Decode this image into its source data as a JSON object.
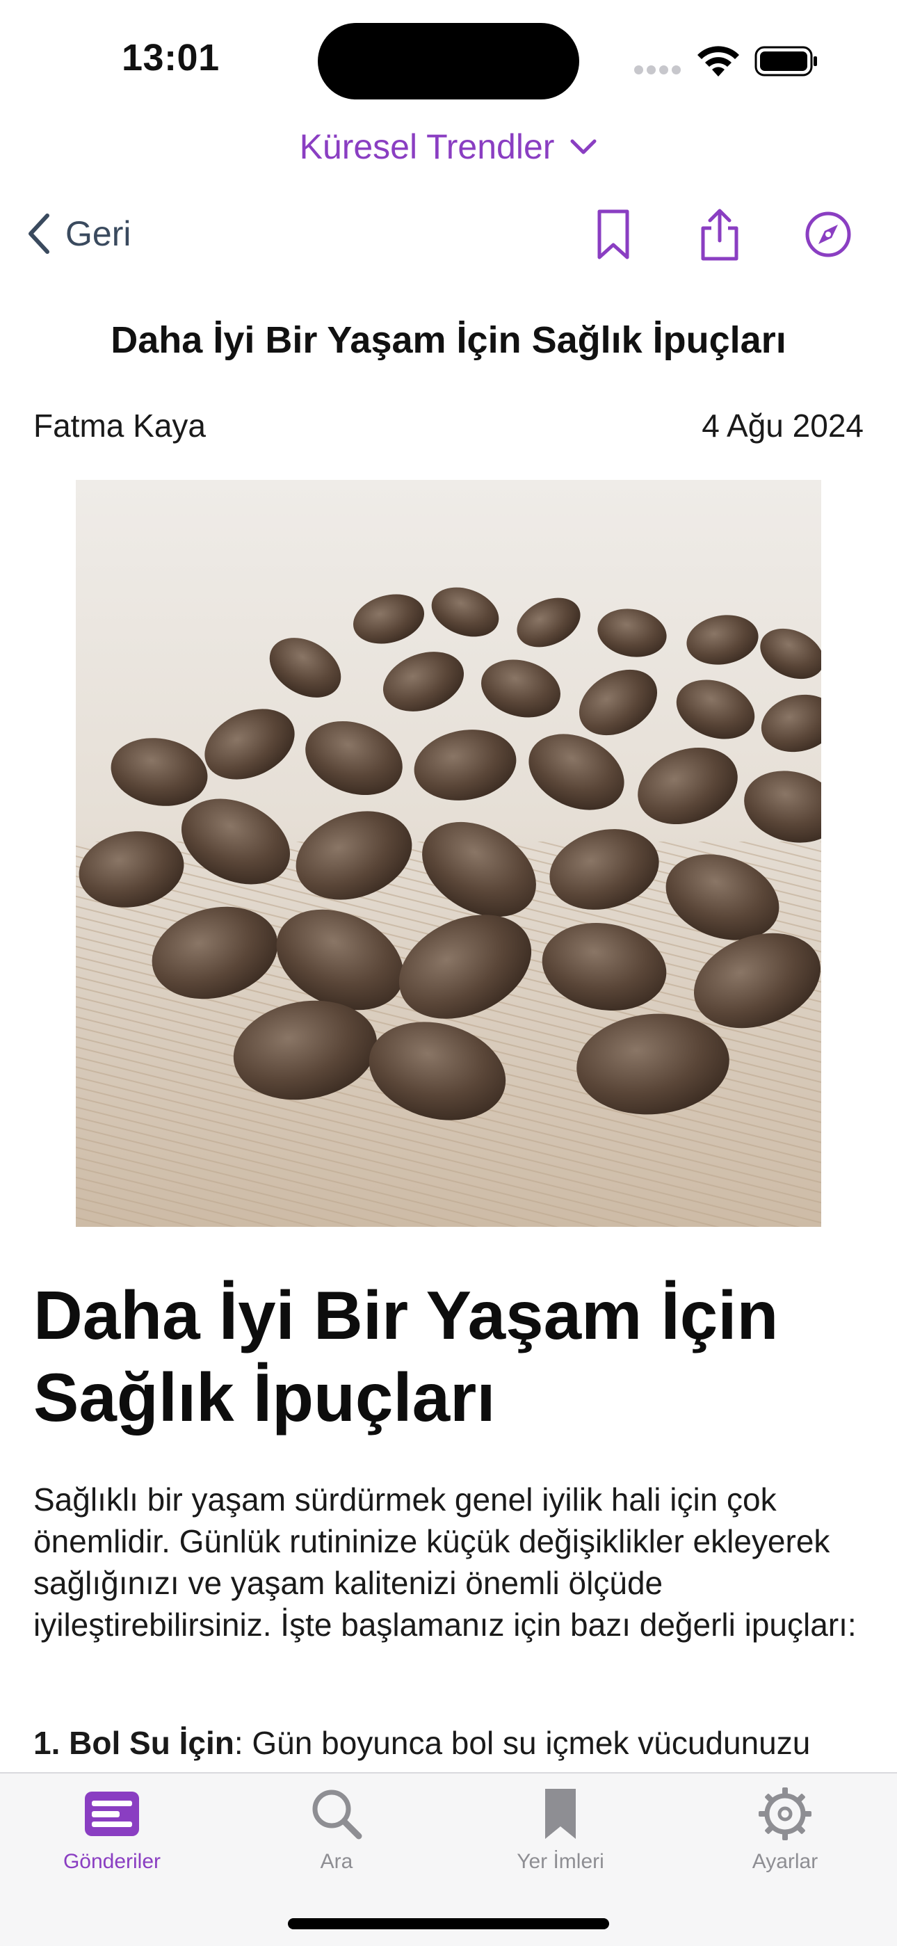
{
  "status_bar": {
    "time": "13:01"
  },
  "feed_switcher": {
    "label": "Küresel Trendler"
  },
  "nav": {
    "back_label": "Geri"
  },
  "post": {
    "title": "Daha İyi Bir Yaşam İçin Sağlık İpuçları",
    "author": "Fatma Kaya",
    "date": "4 Ağu 2024",
    "image_alt": "coffee-beans-photo"
  },
  "article": {
    "heading_line1": "Daha İyi Bir Yaşam İçin",
    "heading_line2": "Sağlık İpuçları",
    "intro": "Sağlıklı bir yaşam sürdürmek genel iyilik hali için çok önemlidir. Günlük rutininize küçük değişiklikler ekleyerek sağlığınızı ve yaşam kalitenizi önemli ölçüde iyileştirebilirsiniz. İşte başlamanız için bazı değerli ipuçları:",
    "tip1_title": "1. Bol Su İçin",
    "tip1_text": ": Gün boyunca bol su içmek vücudunuzu"
  },
  "tabbar": {
    "tabs": [
      {
        "label": "Gönderiler",
        "icon": "posts-icon",
        "active": true
      },
      {
        "label": "Ara",
        "icon": "search-icon",
        "active": false
      },
      {
        "label": "Yer İmleri",
        "icon": "bookmark-icon",
        "active": false
      },
      {
        "label": "Ayarlar",
        "icon": "gear-icon",
        "active": false
      }
    ]
  },
  "colors": {
    "accent": "#8a3ec2",
    "inactive": "#8e8e93",
    "back": "#3a4a5e"
  }
}
